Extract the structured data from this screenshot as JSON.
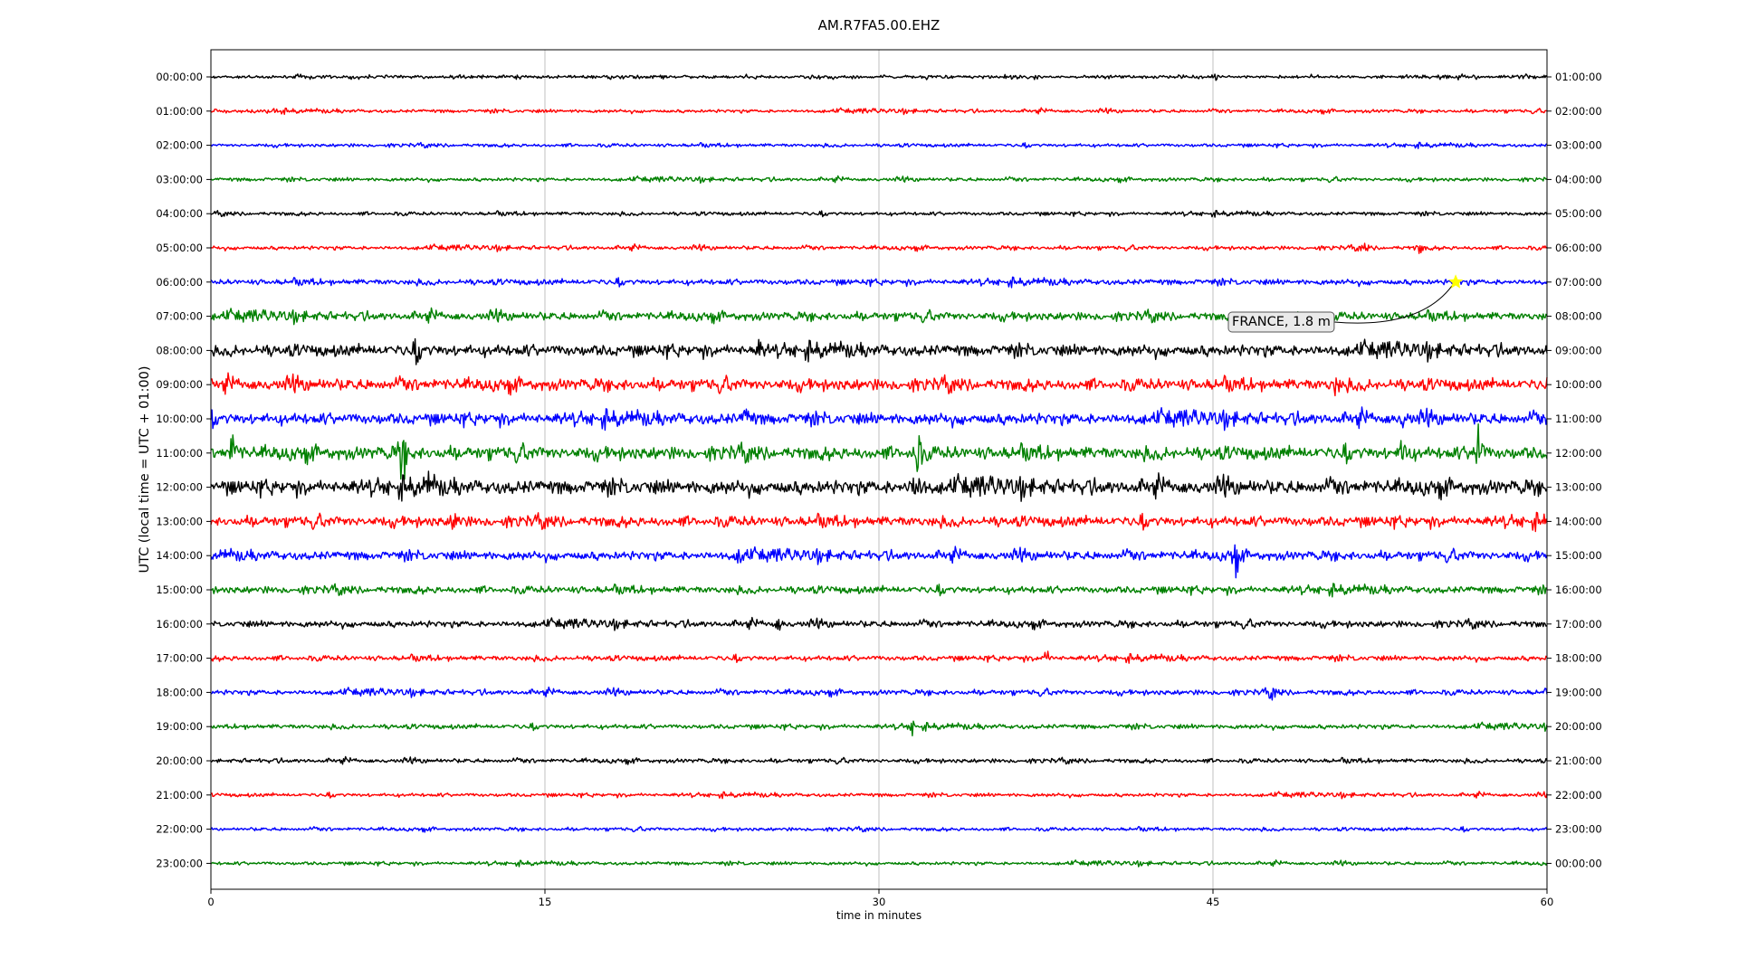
{
  "chart_data": {
    "type": "line",
    "title": "AM.R7FA5.00.EHZ",
    "xlabel": "time in minutes",
    "ylabel": "UTC (local time = UTC + 01:00)",
    "xlim": [
      0,
      60
    ],
    "xticks": [
      "0",
      "15",
      "30",
      "45",
      "60"
    ],
    "grid": "vertical",
    "left_labels": [
      "00:00:00",
      "01:00:00",
      "02:00:00",
      "03:00:00",
      "04:00:00",
      "05:00:00",
      "06:00:00",
      "07:00:00",
      "08:00:00",
      "09:00:00",
      "10:00:00",
      "11:00:00",
      "12:00:00",
      "13:00:00",
      "14:00:00",
      "15:00:00",
      "16:00:00",
      "17:00:00",
      "18:00:00",
      "19:00:00",
      "20:00:00",
      "21:00:00",
      "22:00:00",
      "23:00:00"
    ],
    "right_labels": [
      "01:00:00",
      "02:00:00",
      "03:00:00",
      "04:00:00",
      "05:00:00",
      "06:00:00",
      "07:00:00",
      "08:00:00",
      "09:00:00",
      "10:00:00",
      "11:00:00",
      "12:00:00",
      "13:00:00",
      "14:00:00",
      "15:00:00",
      "16:00:00",
      "17:00:00",
      "18:00:00",
      "19:00:00",
      "20:00:00",
      "21:00:00",
      "22:00:00",
      "23:00:00",
      "00:00:00"
    ],
    "color_cycle": [
      "#000000",
      "#ff0000",
      "#0000ff",
      "#008000"
    ],
    "noise_level": [
      1.2,
      1.3,
      1.3,
      1.4,
      1.4,
      1.5,
      2.2,
      3.2,
      4.5,
      4.5,
      4.5,
      5.0,
      5.5,
      4.0,
      3.5,
      2.8,
      2.5,
      2.0,
      2.0,
      1.8,
      1.6,
      1.4,
      1.3,
      1.3
    ],
    "spikes": [
      {
        "row": 0,
        "minute": 45.1,
        "amp": 4
      },
      {
        "row": 5,
        "minute": 51.8,
        "amp": 6
      },
      {
        "row": 5,
        "minute": 54.3,
        "amp": 6
      },
      {
        "row": 8,
        "minute": 9.3,
        "amp": 10
      },
      {
        "row": 8,
        "minute": 24.6,
        "amp": 9
      },
      {
        "row": 9,
        "minute": 50.5,
        "amp": 10
      },
      {
        "row": 10,
        "minute": 24.1,
        "amp": 14
      },
      {
        "row": 10,
        "minute": 53.6,
        "amp": 10
      },
      {
        "row": 11,
        "minute": 1.0,
        "amp": 22
      },
      {
        "row": 11,
        "minute": 8.6,
        "amp": 32
      },
      {
        "row": 11,
        "minute": 31.7,
        "amp": 36
      },
      {
        "row": 11,
        "minute": 53.6,
        "amp": 24
      },
      {
        "row": 11,
        "minute": 56.9,
        "amp": 38
      },
      {
        "row": 12,
        "minute": 31.7,
        "amp": 34
      },
      {
        "row": 12,
        "minute": 9.8,
        "amp": 12
      },
      {
        "row": 13,
        "minute": 11.0,
        "amp": 14
      },
      {
        "row": 14,
        "minute": 46.0,
        "amp": 20
      },
      {
        "row": 14,
        "minute": 23.8,
        "amp": 10
      },
      {
        "row": 16,
        "minute": 25.5,
        "amp": 8
      },
      {
        "row": 17,
        "minute": 37.5,
        "amp": 8
      },
      {
        "row": 18,
        "minute": 47.7,
        "amp": 8
      },
      {
        "row": 19,
        "minute": 31.5,
        "amp": 6
      }
    ],
    "event_marker": {
      "row": 6,
      "minute": 55.9,
      "color": "#ffff00",
      "label": "FRANCE, 1.8 m"
    }
  }
}
